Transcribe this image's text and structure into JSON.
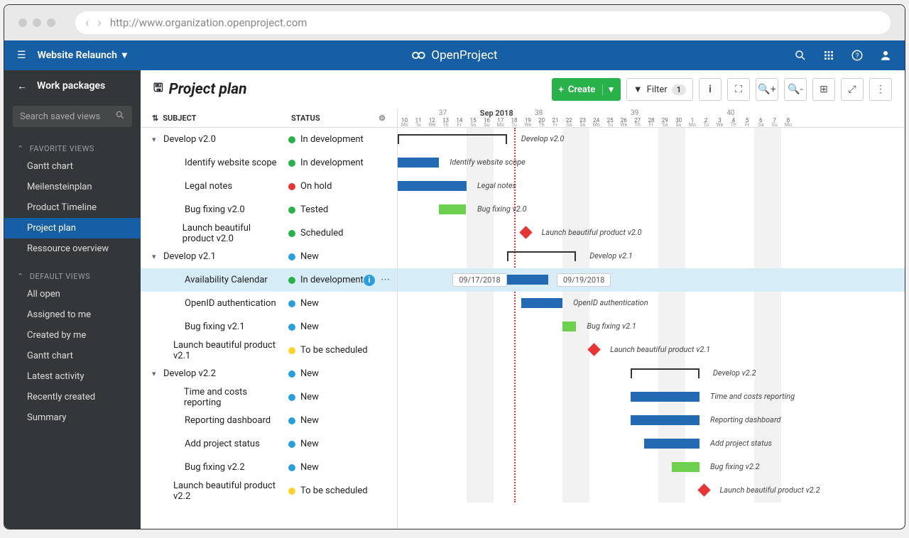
{
  "browser": {
    "url": "http://www.organization.openproject.com"
  },
  "top": {
    "project": "Website Relaunch",
    "brand": "OpenProject"
  },
  "sidebar": {
    "back_label": "Work packages",
    "search_placeholder": "Search saved views",
    "favorite_head": "FAVORITE VIEWS",
    "favorite_items": [
      "Gantt chart",
      "Meilensteinplan",
      "Product Timeline",
      "Project plan",
      "Ressource overview"
    ],
    "favorite_active": 3,
    "default_head": "DEFAULT VIEWS",
    "default_items": [
      "All open",
      "Assigned to me",
      "Created by me",
      "Gantt chart",
      "Latest activity",
      "Recently created",
      "Summary"
    ]
  },
  "toolbar": {
    "title": "Project plan",
    "create_label": "Create",
    "filter_label": "Filter",
    "filter_count": "1"
  },
  "columns": {
    "subject": "SUBJECT",
    "status": "STATUS"
  },
  "timeline": {
    "month": "Sep 2018",
    "weeks": [
      "37",
      "38",
      "39",
      "40"
    ],
    "days": [
      {
        "n": "10",
        "w": "Mo"
      },
      {
        "n": "11",
        "w": "Tu"
      },
      {
        "n": "12",
        "w": "We"
      },
      {
        "n": "13",
        "w": "Th"
      },
      {
        "n": "14",
        "w": "Fr"
      },
      {
        "n": "15",
        "w": "Sa"
      },
      {
        "n": "16",
        "w": "Su"
      },
      {
        "n": "17",
        "w": "Mo"
      },
      {
        "n": "18",
        "w": "Tu"
      },
      {
        "n": "19",
        "w": "We"
      },
      {
        "n": "20",
        "w": "Th"
      },
      {
        "n": "21",
        "w": "Fr"
      },
      {
        "n": "22",
        "w": "Sa"
      },
      {
        "n": "23",
        "w": "Su"
      },
      {
        "n": "24",
        "w": "Mo"
      },
      {
        "n": "25",
        "w": "Tu"
      },
      {
        "n": "26",
        "w": "We"
      },
      {
        "n": "27",
        "w": "Th"
      },
      {
        "n": "28",
        "w": "Fr"
      },
      {
        "n": "29",
        "w": "Sa"
      },
      {
        "n": "30",
        "w": "Su"
      },
      {
        "n": "1",
        "w": "Mo"
      },
      {
        "n": "2",
        "w": "Tu"
      },
      {
        "n": "3",
        "w": "We"
      },
      {
        "n": "4",
        "w": "Th"
      },
      {
        "n": "5",
        "w": "Fr"
      },
      {
        "n": "6",
        "w": "Sa"
      },
      {
        "n": "7",
        "w": "Su"
      },
      {
        "n": "8",
        "w": "Mo"
      }
    ]
  },
  "rows": [
    {
      "lvl": 0,
      "exp": true,
      "subject": "Develop v2.0",
      "status": "In development",
      "dot": "green",
      "type": "bracket",
      "start": 0,
      "end": 8,
      "label": "Develop v2.0"
    },
    {
      "lvl": 2,
      "subject": "Identify website scope",
      "status": "In development",
      "dot": "green",
      "type": "bar",
      "color": "blue",
      "start": 0,
      "end": 3,
      "label": "Identify website scope"
    },
    {
      "lvl": 2,
      "subject": "Legal notes",
      "status": "On hold",
      "dot": "red",
      "type": "bar",
      "color": "blue",
      "start": 0,
      "end": 5,
      "label": "Legal notes"
    },
    {
      "lvl": 2,
      "subject": "Bug fixing v2.0",
      "status": "Tested",
      "dot": "green",
      "type": "bar",
      "color": "green",
      "start": 3,
      "end": 5,
      "label": "Bug fixing v2.0"
    },
    {
      "lvl": 2,
      "subject": "Launch beautiful product v2.0",
      "status": "Scheduled",
      "dot": "green",
      "type": "diamond",
      "at": 9,
      "label": "Launch beautiful product v2.0"
    },
    {
      "lvl": 0,
      "exp": true,
      "subject": "Develop v2.1",
      "status": "New",
      "dot": "blue",
      "type": "bracket",
      "start": 8,
      "end": 13,
      "label": "Develop v2.1"
    },
    {
      "lvl": 2,
      "hl": true,
      "subject": "Availability Calendar",
      "status": "In development",
      "dot": "green",
      "info": true,
      "type": "bar",
      "color": "blue",
      "start": 8,
      "end": 11,
      "date_start": "09/17/2018",
      "date_end": "09/19/2018"
    },
    {
      "lvl": 2,
      "subject": "OpenID authentication",
      "status": "New",
      "dot": "blue",
      "type": "bar",
      "color": "blue",
      "start": 9,
      "end": 12,
      "label": "OpenID authentication"
    },
    {
      "lvl": 2,
      "subject": "Bug fixing v2.1",
      "status": "New",
      "dot": "blue",
      "type": "bar",
      "color": "green",
      "start": 12,
      "end": 13,
      "label": "Bug fixing v2.1"
    },
    {
      "lvl": 1,
      "subject": "Launch beautiful product v2.1",
      "status": "To be scheduled",
      "dot": "yellow",
      "type": "diamond",
      "at": 14,
      "label": "Launch beautiful product v2.1"
    },
    {
      "lvl": 0,
      "exp": true,
      "subject": "Develop v2.2",
      "status": "New",
      "dot": "blue",
      "type": "bracket",
      "start": 17,
      "end": 22,
      "label": "Develop v2.2"
    },
    {
      "lvl": 2,
      "subject": "Time and costs reporting",
      "status": "New",
      "dot": "blue",
      "type": "bar",
      "color": "blue",
      "start": 17,
      "end": 22,
      "label": "Time and costs reporting"
    },
    {
      "lvl": 2,
      "subject": "Reporting dashboard",
      "status": "New",
      "dot": "blue",
      "type": "bar",
      "color": "blue",
      "start": 17,
      "end": 22,
      "label": "Reporting dashboard"
    },
    {
      "lvl": 2,
      "subject": "Add project status",
      "status": "New",
      "dot": "blue",
      "type": "bar",
      "color": "blue",
      "start": 18,
      "end": 22,
      "label": "Add project status"
    },
    {
      "lvl": 2,
      "subject": "Bug fixing v2.2",
      "status": "New",
      "dot": "blue",
      "type": "bar",
      "color": "green",
      "start": 20,
      "end": 22,
      "label": "Bug fixing v2.2"
    },
    {
      "lvl": 1,
      "subject": "Launch beautiful product v2.2",
      "status": "To be scheduled",
      "dot": "yellow",
      "type": "diamond",
      "at": 22,
      "label": "Launch beautiful product v2.2"
    }
  ],
  "chart_data": {
    "type": "gantt",
    "title": "Project plan",
    "month": "Sep 2018",
    "timeline_start": "2018-09-10",
    "today": "2018-09-18",
    "tasks": [
      {
        "name": "Develop v2.0",
        "kind": "summary",
        "start": "2018-09-10",
        "end": "2018-09-18"
      },
      {
        "name": "Identify website scope",
        "kind": "task",
        "start": "2018-09-10",
        "end": "2018-09-13"
      },
      {
        "name": "Legal notes",
        "kind": "task",
        "start": "2018-09-10",
        "end": "2018-09-15"
      },
      {
        "name": "Bug fixing v2.0",
        "kind": "task",
        "start": "2018-09-13",
        "end": "2018-09-15"
      },
      {
        "name": "Launch beautiful product v2.0",
        "kind": "milestone",
        "date": "2018-09-19"
      },
      {
        "name": "Develop v2.1",
        "kind": "summary",
        "start": "2018-09-18",
        "end": "2018-09-23"
      },
      {
        "name": "Availability Calendar",
        "kind": "task",
        "start": "2018-09-17",
        "end": "2018-09-19"
      },
      {
        "name": "OpenID authentication",
        "kind": "task",
        "start": "2018-09-19",
        "end": "2018-09-22"
      },
      {
        "name": "Bug fixing v2.1",
        "kind": "task",
        "start": "2018-09-22",
        "end": "2018-09-23"
      },
      {
        "name": "Launch beautiful product v2.1",
        "kind": "milestone",
        "date": "2018-09-24"
      },
      {
        "name": "Develop v2.2",
        "kind": "summary",
        "start": "2018-09-27",
        "end": "2018-10-02"
      },
      {
        "name": "Time and costs reporting",
        "kind": "task",
        "start": "2018-09-27",
        "end": "2018-10-02"
      },
      {
        "name": "Reporting dashboard",
        "kind": "task",
        "start": "2018-09-27",
        "end": "2018-10-02"
      },
      {
        "name": "Add project status",
        "kind": "task",
        "start": "2018-09-28",
        "end": "2018-10-02"
      },
      {
        "name": "Bug fixing v2.2",
        "kind": "task",
        "start": "2018-09-30",
        "end": "2018-10-02"
      },
      {
        "name": "Launch beautiful product v2.2",
        "kind": "milestone",
        "date": "2018-10-02"
      }
    ]
  }
}
